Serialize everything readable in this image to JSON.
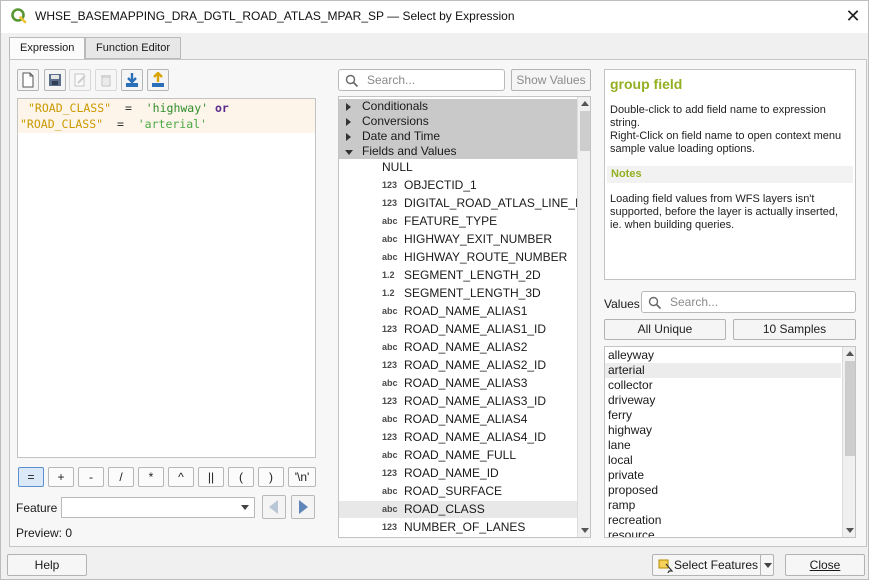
{
  "window": {
    "title": "WHSE_BASEMAPPING_DRA_DGTL_ROAD_ATLAS_MPAR_SP — Select by Expression"
  },
  "tabs": [
    {
      "label": "Expression",
      "active": true
    },
    {
      "label": "Function Editor",
      "active": false
    }
  ],
  "toolbar": {
    "icons": [
      "new-file-icon",
      "save-icon",
      "edit-icon",
      "delete-icon",
      "import-icon",
      "export-icon"
    ]
  },
  "expression": {
    "line1": {
      "field": "\"ROAD_CLASS\"",
      "op": "=",
      "str": "'highway'",
      "kw": "or"
    },
    "line2": {
      "field": "\"ROAD_CLASS\"",
      "op": "=",
      "str": "'arterial'"
    }
  },
  "operators": [
    "=",
    "+",
    "-",
    "/",
    "*",
    "^",
    "||",
    "(",
    ")",
    "'\\n'"
  ],
  "feature": {
    "label": "Feature",
    "value": ""
  },
  "preview": {
    "text": "Preview:  0"
  },
  "function_search": {
    "placeholder": "Search...",
    "show_values_label": "Show Values"
  },
  "tree": {
    "groups": [
      "Conditionals",
      "Conversions",
      "Date and Time",
      "Fields and Values"
    ],
    "fields": [
      {
        "type": "",
        "name": "NULL"
      },
      {
        "type": "123",
        "name": "OBJECTID_1"
      },
      {
        "type": "123",
        "name": "DIGITAL_ROAD_ATLAS_LINE_ID"
      },
      {
        "type": "abc",
        "name": "FEATURE_TYPE"
      },
      {
        "type": "abc",
        "name": "HIGHWAY_EXIT_NUMBER"
      },
      {
        "type": "abc",
        "name": "HIGHWAY_ROUTE_NUMBER"
      },
      {
        "type": "1.2",
        "name": "SEGMENT_LENGTH_2D"
      },
      {
        "type": "1.2",
        "name": "SEGMENT_LENGTH_3D"
      },
      {
        "type": "abc",
        "name": "ROAD_NAME_ALIAS1"
      },
      {
        "type": "123",
        "name": "ROAD_NAME_ALIAS1_ID"
      },
      {
        "type": "abc",
        "name": "ROAD_NAME_ALIAS2"
      },
      {
        "type": "123",
        "name": "ROAD_NAME_ALIAS2_ID"
      },
      {
        "type": "abc",
        "name": "ROAD_NAME_ALIAS3"
      },
      {
        "type": "123",
        "name": "ROAD_NAME_ALIAS3_ID"
      },
      {
        "type": "abc",
        "name": "ROAD_NAME_ALIAS4"
      },
      {
        "type": "123",
        "name": "ROAD_NAME_ALIAS4_ID"
      },
      {
        "type": "abc",
        "name": "ROAD_NAME_FULL"
      },
      {
        "type": "123",
        "name": "ROAD_NAME_ID"
      },
      {
        "type": "abc",
        "name": "ROAD_SURFACE"
      },
      {
        "type": "abc",
        "name": "ROAD_CLASS",
        "selected": true
      },
      {
        "type": "123",
        "name": "NUMBER_OF_LANES"
      }
    ]
  },
  "help": {
    "title": "group field",
    "text1": "Double-click to add field name to expression string.",
    "text2": "Right-Click on field name to open context menu sample value loading options.",
    "notes_title": "Notes",
    "notes_text": "Loading field values from WFS layers isn't supported, before the layer is actually inserted, ie. when building queries."
  },
  "values": {
    "label": "Values",
    "search_placeholder": "Search...",
    "all_unique_label": "All Unique",
    "samples_label": "10 Samples",
    "items": [
      "alleyway",
      "arterial",
      "collector",
      "driveway",
      "ferry",
      "highway",
      "lane",
      "local",
      "private",
      "proposed",
      "ramp",
      "recreation",
      "resource"
    ],
    "selected_index": 1
  },
  "buttons": {
    "help": "Help",
    "select_features": "Select Features",
    "close": "Close"
  },
  "colors": {
    "accent_green": "#93b023",
    "field_yellow": "#c99a00",
    "string_green": "#2f8e2a",
    "keyword_purple": "#5d2a8c"
  }
}
